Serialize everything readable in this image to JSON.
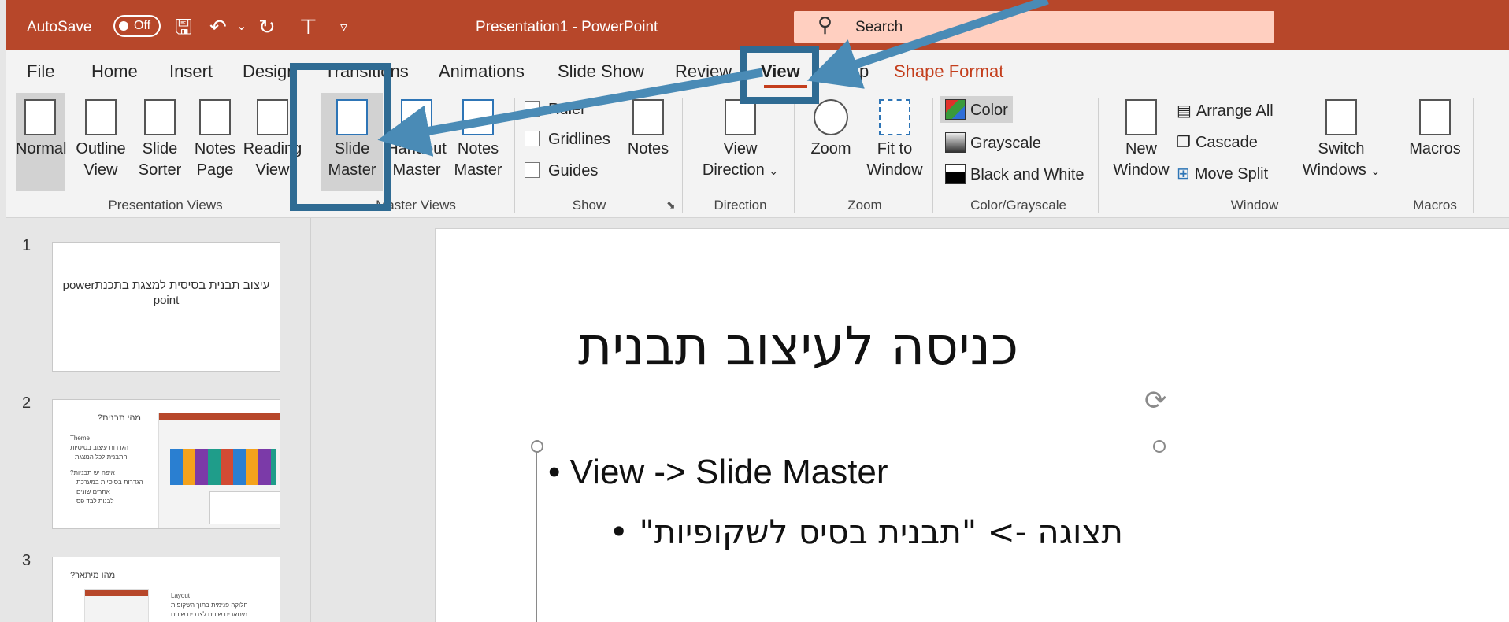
{
  "titlebar": {
    "autosave_label": "AutoSave",
    "autosave_state": "Off",
    "window_title": "Presentation1  -  PowerPoint",
    "search_placeholder": "Search"
  },
  "tabs": [
    {
      "label": "File"
    },
    {
      "label": "Home"
    },
    {
      "label": "Insert"
    },
    {
      "label": "Design"
    },
    {
      "label": "Transitions"
    },
    {
      "label": "Animations"
    },
    {
      "label": "Slide Show"
    },
    {
      "label": "Review"
    },
    {
      "label": "View",
      "active": true
    },
    {
      "label": "Help"
    },
    {
      "label": "Shape Format"
    }
  ],
  "ribbon": {
    "presentation_views": {
      "group_label": "Presentation Views",
      "normal": "Normal",
      "outline_view_1": "Outline",
      "outline_view_2": "View",
      "slide_sorter_1": "Slide",
      "slide_sorter_2": "Sorter",
      "notes_page_1": "Notes",
      "notes_page_2": "Page",
      "reading_view_1": "Reading",
      "reading_view_2": "View"
    },
    "master_views": {
      "group_label": "Master Views",
      "slide_master_1": "Slide",
      "slide_master_2": "Master",
      "handout_master_1": "Handout",
      "handout_master_2": "Master",
      "notes_master_1": "Notes",
      "notes_master_2": "Master"
    },
    "show": {
      "group_label": "Show",
      "ruler": "Ruler",
      "gridlines": "Gridlines",
      "guides": "Guides",
      "notes": "Notes"
    },
    "direction": {
      "group_label": "Direction",
      "view_direction_1": "View",
      "view_direction_2": "Direction"
    },
    "zoom": {
      "group_label": "Zoom",
      "zoom": "Zoom",
      "fit_1": "Fit to",
      "fit_2": "Window"
    },
    "color": {
      "group_label": "Color/Grayscale",
      "color": "Color",
      "grayscale": "Grayscale",
      "bw": "Black and White"
    },
    "window": {
      "group_label": "Window",
      "new_window_1": "New",
      "new_window_2": "Window",
      "arrange_all": "Arrange All",
      "cascade": "Cascade",
      "move_split": "Move Split",
      "switch_1": "Switch",
      "switch_2": "Windows"
    },
    "macros": {
      "group_label": "Macros",
      "macros": "Macros"
    }
  },
  "slides": [
    {
      "number": "1",
      "title": "עיצוב תבנית בסיסית למצגת בתכנתpower point"
    },
    {
      "number": "2",
      "title": "מהי תבנית?",
      "lines": [
        "Theme",
        "הגדרות עיצוב בסיסיות",
        "התבנית לכל המצגת",
        "איפה יש תבניות?",
        "הגדרות בסיסיות במערכת",
        "אתרים שונים",
        "לבנות לבד פס"
      ]
    },
    {
      "number": "3",
      "title": "מהו מיתאר?",
      "lines": [
        "Layout",
        "חלוקה פנימית בתוך השקופית",
        "מיתארים שונים לצרכים שונים"
      ]
    }
  ],
  "slide": {
    "title": "כניסה לעיצוב תבנית",
    "bullet1": "• View -> Slide Master",
    "bullet2": "תצוגה -> \"תבנית בסיס לשקופיות\" •"
  },
  "colors": {
    "titlebar": "#b7472a",
    "accent": "#c43e1c",
    "annotation": "#2f6b93"
  }
}
